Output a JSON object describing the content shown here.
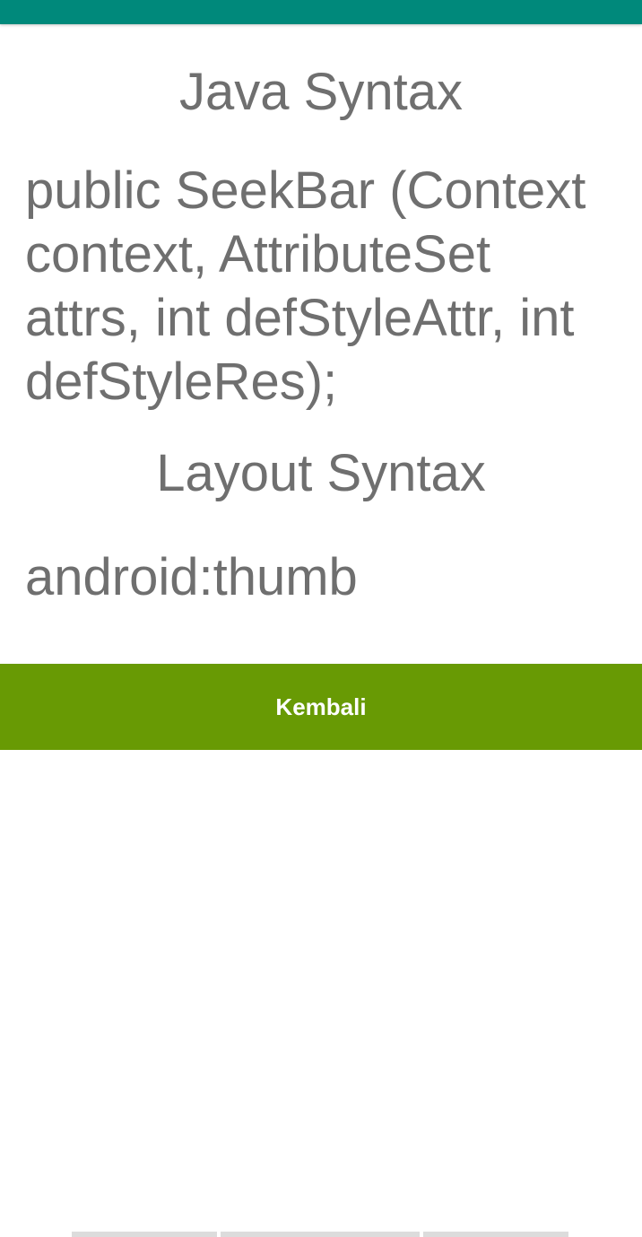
{
  "status_bar": {
    "color": "#00897B"
  },
  "main": {
    "java_heading": "Java Syntax",
    "java_code": "public SeekBar (Context context, AttributeSet attrs, int defStyleAttr, int defStyleRes);",
    "layout_heading": "Layout Syntax",
    "layout_attr": "android:thumb"
  },
  "buttons": {
    "back_label": "Kembali",
    "back_color": "#689A04"
  },
  "colors": {
    "text": "#6f6f6f",
    "background": "#ffffff"
  }
}
